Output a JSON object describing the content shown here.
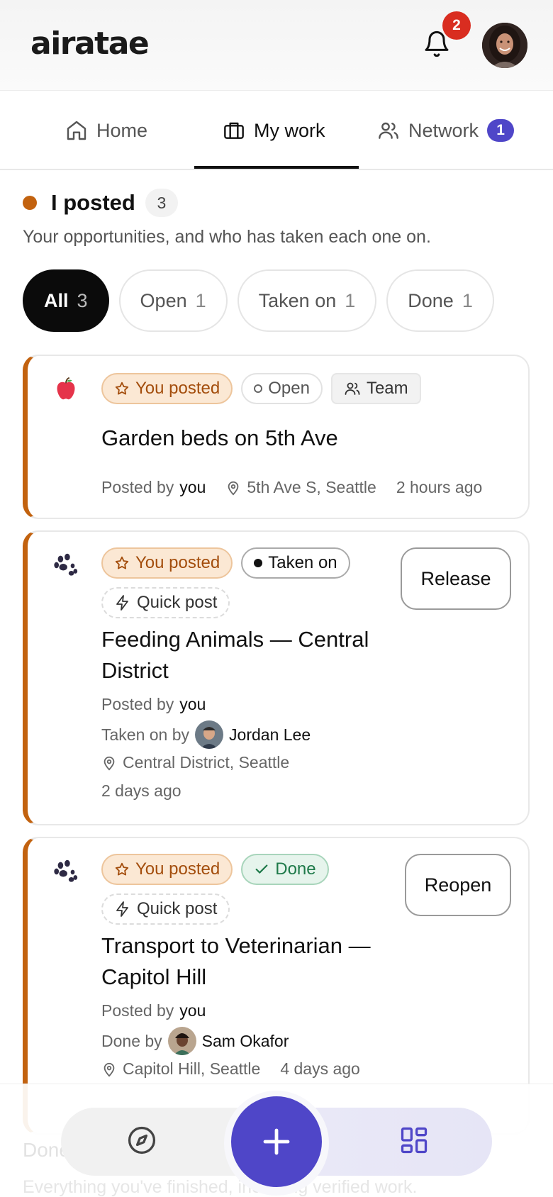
{
  "app": {
    "logo": "airatae"
  },
  "header": {
    "notifications_count": "2"
  },
  "tabs": [
    {
      "label": "Home",
      "active": false
    },
    {
      "label": "My work",
      "active": true
    },
    {
      "label": "Network",
      "badge": "1",
      "active": false
    }
  ],
  "section": {
    "title": "I posted",
    "count": "3",
    "subtitle": "Your opportunities, and who has taken each one on.",
    "accent": "#c2620f"
  },
  "filters": [
    {
      "label": "All",
      "count": "3",
      "active": true
    },
    {
      "label": "Open",
      "count": "1",
      "active": false
    },
    {
      "label": "Taken on",
      "count": "1",
      "active": false
    },
    {
      "label": "Done",
      "count": "1",
      "active": false
    }
  ],
  "cards": [
    {
      "icon": "apple-icon",
      "tags": {
        "posted": "You posted",
        "status": "Open",
        "extra": "Team"
      },
      "title": "Garden beds on 5th Ave",
      "posted_by_label": "Posted by",
      "posted_by": "you",
      "location": "5th Ave S, Seattle",
      "time": "2 hours ago"
    },
    {
      "icon": "paw-icon",
      "tags": {
        "posted": "You posted",
        "status": "Taken on",
        "extra": "Quick post"
      },
      "title_line1": "Feeding Animals — Central",
      "title_line2": "District",
      "posted_by_label": "Posted by",
      "posted_by": "you",
      "taker_label": "Taken on by",
      "taker": "Jordan Lee",
      "location": "Central District, Seattle",
      "time": "2 days ago",
      "action": "Release"
    },
    {
      "icon": "paw-icon",
      "tags": {
        "posted": "You posted",
        "status": "Done",
        "extra": "Quick post"
      },
      "title_line1": "Transport to Veterinarian —",
      "title_line2": "Capitol Hill",
      "posted_by_label": "Posted by",
      "posted_by": "you",
      "taker_label": "Done by",
      "taker": "Sam Okafor",
      "location": "Capitol Hill, Seattle",
      "time": "4 days ago",
      "action": "Reopen"
    }
  ],
  "background_peek": {
    "heading": "Done",
    "text": "Everything you've finished, including verified work."
  },
  "colors": {
    "brand": "#4f46c8",
    "accent_orange": "#c2620f",
    "badge_red": "#d92d20"
  }
}
